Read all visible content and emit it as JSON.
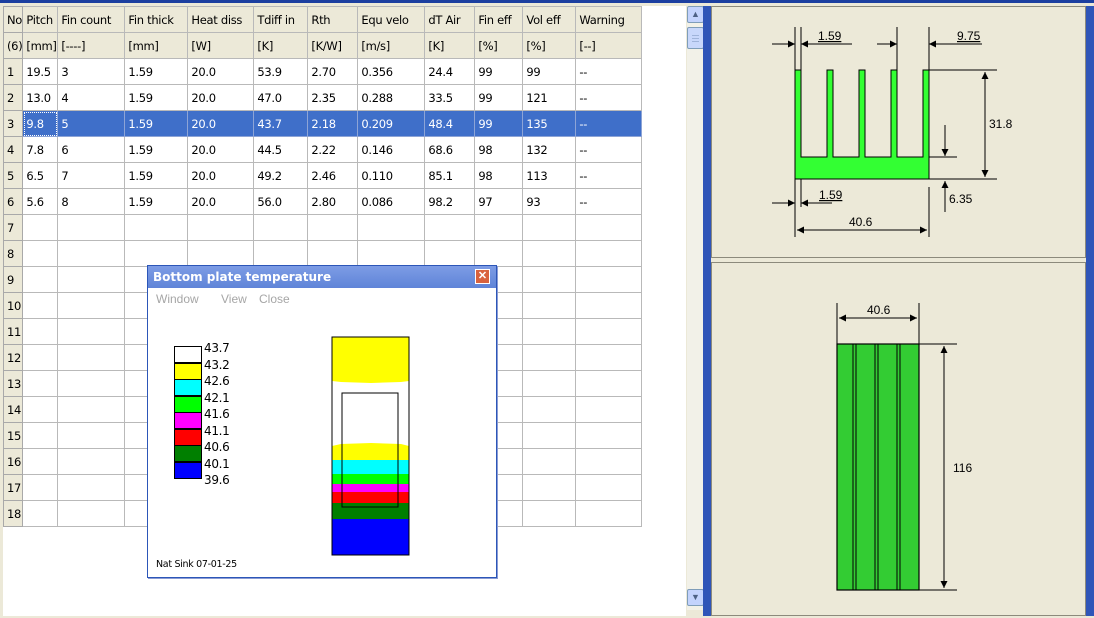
{
  "table": {
    "headers": [
      "No",
      "Pitch",
      "Fin count",
      "Fin thick",
      "Heat diss",
      "Tdiff in",
      "Rth",
      "Equ velo",
      "dT Air",
      "Fin eff",
      "Vol eff",
      "Warning"
    ],
    "units": [
      "(6)",
      "[mm]",
      "[----]",
      "[mm]",
      "[W]",
      "[K]",
      "[K/W]",
      "[m/s]",
      "[K]",
      "[%]",
      "[%]",
      "[--]"
    ],
    "rows": [
      [
        "1",
        "19.5",
        "3",
        "1.59",
        "20.0",
        "53.9",
        "2.70",
        "0.356",
        "24.4",
        "99",
        "99",
        "--"
      ],
      [
        "2",
        "13.0",
        "4",
        "1.59",
        "20.0",
        "47.0",
        "2.35",
        "0.288",
        "33.5",
        "99",
        "121",
        "--"
      ],
      [
        "3",
        "9.8",
        "5",
        "1.59",
        "20.0",
        "43.7",
        "2.18",
        "0.209",
        "48.4",
        "99",
        "135",
        "--"
      ],
      [
        "4",
        "7.8",
        "6",
        "1.59",
        "20.0",
        "44.5",
        "2.22",
        "0.146",
        "68.6",
        "98",
        "132",
        "--"
      ],
      [
        "5",
        "6.5",
        "7",
        "1.59",
        "20.0",
        "49.2",
        "2.46",
        "0.110",
        "85.1",
        "98",
        "113",
        "--"
      ],
      [
        "6",
        "5.6",
        "8",
        "1.59",
        "20.0",
        "56.0",
        "2.80",
        "0.086",
        "98.2",
        "97",
        "93",
        "--"
      ],
      [
        "7",
        "",
        "",
        "",
        "",
        "",
        "",
        "",
        "",
        "",
        "",
        ""
      ],
      [
        "8",
        "",
        "",
        "",
        "",
        "",
        "",
        "",
        "",
        "",
        "",
        ""
      ],
      [
        "9",
        "",
        "",
        "",
        "",
        "",
        "",
        "",
        "",
        "",
        "",
        ""
      ],
      [
        "10",
        "",
        "",
        "",
        "",
        "",
        "",
        "",
        "",
        "",
        "",
        ""
      ],
      [
        "11",
        "",
        "",
        "",
        "",
        "",
        "",
        "",
        "",
        "",
        "",
        ""
      ],
      [
        "12",
        "",
        "",
        "",
        "",
        "",
        "",
        "",
        "",
        "",
        "",
        ""
      ],
      [
        "13",
        "",
        "",
        "",
        "",
        "",
        "",
        "",
        "",
        "",
        "",
        ""
      ],
      [
        "14",
        "",
        "",
        "",
        "",
        "",
        "",
        "",
        "",
        "",
        "",
        ""
      ],
      [
        "15",
        "",
        "",
        "",
        "",
        "",
        "",
        "",
        "",
        "",
        "",
        ""
      ],
      [
        "16",
        "",
        "",
        "",
        "",
        "",
        "",
        "",
        "",
        "",
        "",
        ""
      ],
      [
        "17",
        "",
        "",
        "",
        "",
        "",
        "",
        "",
        "",
        "",
        "",
        ""
      ],
      [
        "18",
        "",
        "",
        "",
        "",
        "",
        "",
        "",
        "",
        "",
        "",
        ""
      ]
    ],
    "selected_row": 3
  },
  "popup": {
    "title": "Bottom plate temperature",
    "menu": [
      "Window",
      "View",
      "Close"
    ],
    "legend": [
      {
        "label": "43.7",
        "color": "#ffffff"
      },
      {
        "label": "43.2",
        "color": "#ffff00"
      },
      {
        "label": "42.6",
        "color": "#00ffff"
      },
      {
        "label": "42.1",
        "color": "#00ff00"
      },
      {
        "label": "41.6",
        "color": "#ff00ff"
      },
      {
        "label": "41.1",
        "color": "#ff0000"
      },
      {
        "label": "40.6",
        "color": "#007f00"
      },
      {
        "label": "40.1",
        "color": "#0000ff"
      },
      {
        "label": "39.6",
        "color": ""
      }
    ],
    "footer": "Nat Sink 07-01-25"
  },
  "drawing_front": {
    "fin_thick": "1.59",
    "gap": "9.75",
    "height": "31.8",
    "base_fin": "1.59",
    "width": "40.6",
    "base_thick": "6.35",
    "fill_color": "#33ff33"
  },
  "drawing_top": {
    "width": "40.6",
    "length": "116",
    "fill_color": "#33cc33"
  }
}
